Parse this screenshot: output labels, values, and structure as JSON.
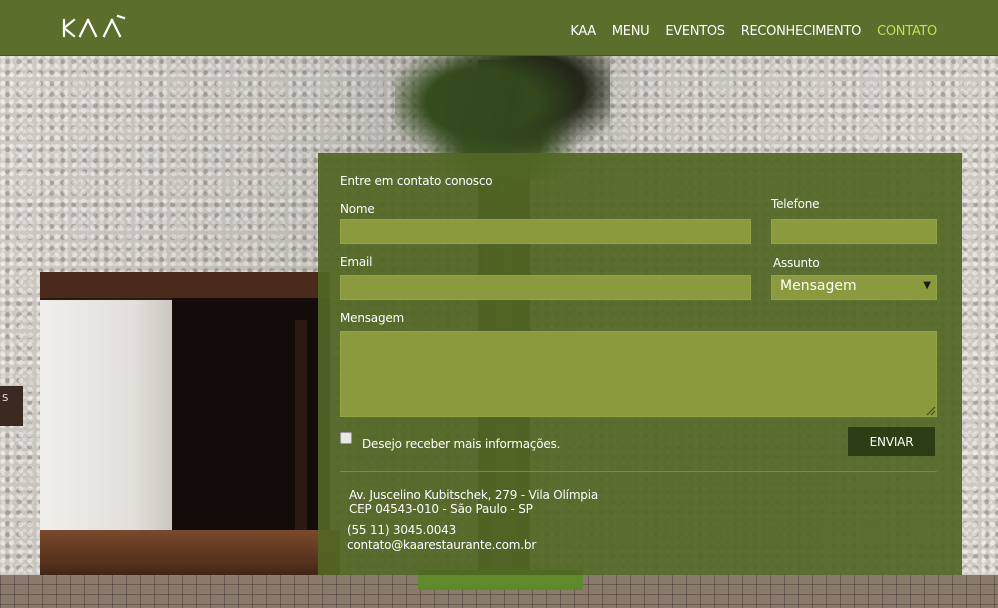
{
  "header": {
    "logo_text": "KAA",
    "nav": [
      {
        "label": "KAA"
      },
      {
        "label": "MENU"
      },
      {
        "label": "EVENTOS"
      },
      {
        "label": "RECONHECIMENTO"
      },
      {
        "label": "CONTATO",
        "active": true
      }
    ]
  },
  "background": {
    "sign_text": "S"
  },
  "form": {
    "title": "Entre em contato conosco",
    "nome_label": "Nome",
    "nome_value": "",
    "telefone_label": "Telefone",
    "telefone_value": "",
    "email_label": "Email",
    "email_value": "",
    "assunto_label": "Assunto",
    "assunto_selected": "Mensagem",
    "mensagem_label": "Mensagem",
    "mensagem_value": "",
    "checkbox_label": "Desejo receber mais informações.",
    "checkbox_checked": false,
    "submit_label": "ENVIAR"
  },
  "address": {
    "line1": "Av. Juscelino Kubitschek, 279 - Vila Olímpia",
    "line2": "CEP 04543-010  - São Paulo - SP",
    "phone": "(55 11) 3045.0043",
    "email": "contato@kaarestaurante.com.br"
  },
  "colors": {
    "header_bg": "#5c6e2c",
    "panel_bg": "#526624",
    "field_bg": "#8a9a3c",
    "active_nav": "#c8dc58",
    "button_bg": "#2e3e14"
  }
}
